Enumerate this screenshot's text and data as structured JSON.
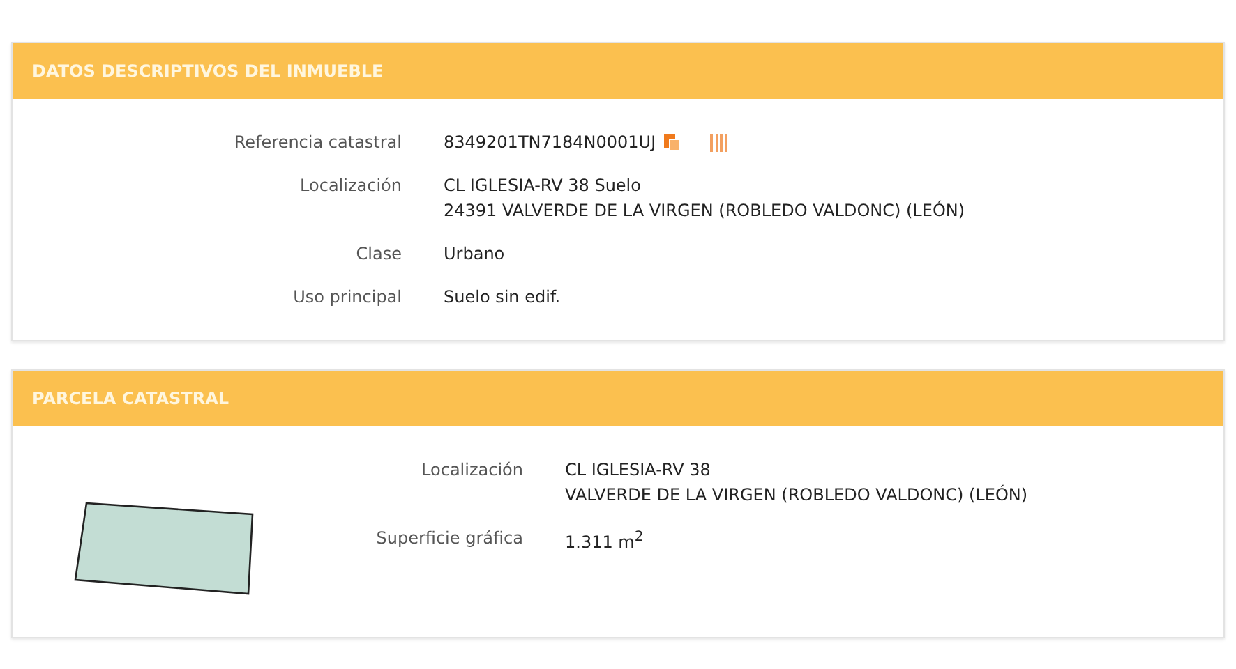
{
  "sections": [
    {
      "kind": "details",
      "title": "DATOS DESCRIPTIVOS DEL INMUEBLE",
      "rows": [
        {
          "label": "Referencia catastral",
          "lines": [
            "8349201TN7184N0001UJ"
          ],
          "kind": "reference"
        },
        {
          "label": "Localización",
          "lines": [
            "CL IGLESIA-RV 38 Suelo",
            "24391 VALVERDE DE LA VIRGEN (ROBLEDO VALDONC) (LEÓN)"
          ],
          "kind": "text"
        },
        {
          "label": "Clase",
          "lines": [
            "Urbano"
          ],
          "kind": "text"
        },
        {
          "label": "Uso principal",
          "lines": [
            "Suelo sin edif."
          ],
          "kind": "text"
        }
      ]
    },
    {
      "kind": "parcel",
      "title": "PARCELA CATASTRAL",
      "rows": [
        {
          "label": "Localización",
          "lines": [
            "CL IGLESIA-RV 38",
            "VALVERDE DE LA VIRGEN (ROBLEDO VALDONC) (LEÓN)"
          ],
          "kind": "text"
        },
        {
          "label": "Superficie gráfica",
          "lines": [
            "1.311 m$^{2}$"
          ],
          "kind": "text"
        }
      ]
    }
  ]
}
